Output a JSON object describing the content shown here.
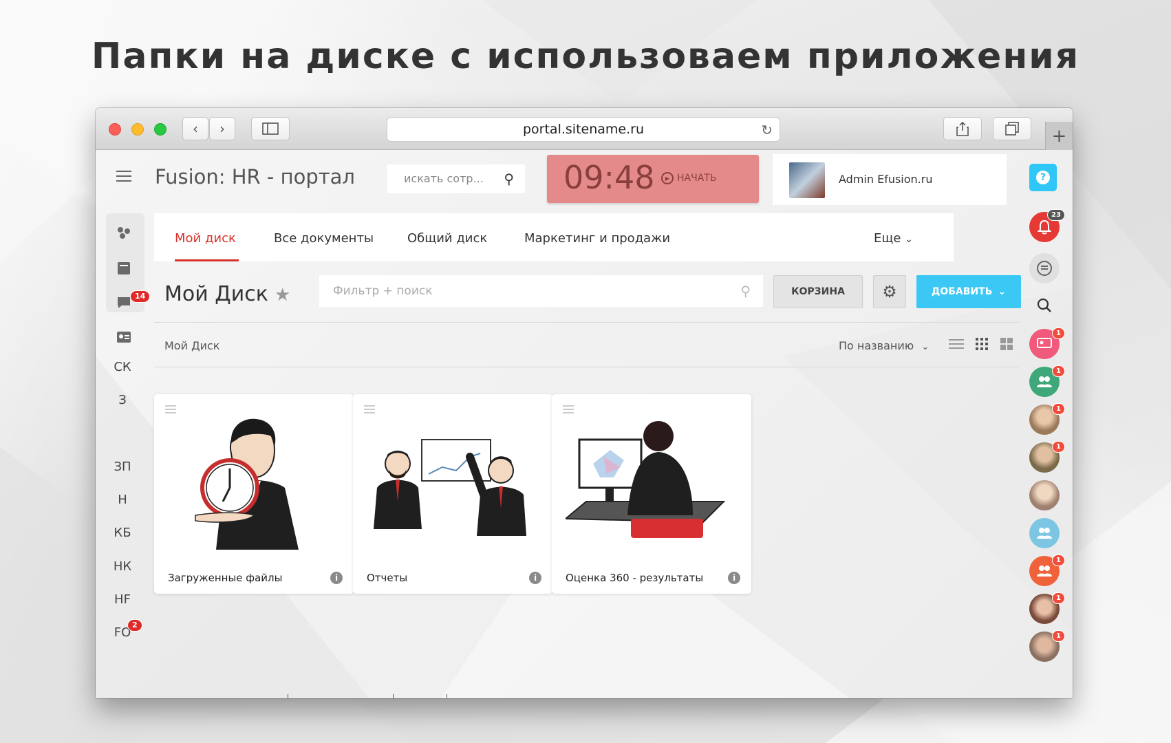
{
  "headline": "Папки на диске с использоваем приложения",
  "browser": {
    "url": "portal.sitename.ru"
  },
  "portal": {
    "title": "Fusion: HR - портал",
    "search_placeholder": "искать сотр...",
    "timer": {
      "time": "09:48",
      "start_label": "НАЧАТЬ"
    },
    "user": {
      "name": "Admin Efusion.ru"
    }
  },
  "left_sidebar": {
    "chat_badge": "14",
    "items": [
      "СК",
      "З",
      "ЗП",
      "Н",
      "КБ",
      "НК",
      "HF",
      "FO"
    ],
    "fo_badge": "2"
  },
  "tabs": [
    {
      "label": "Мой диск",
      "active": true
    },
    {
      "label": "Все документы",
      "active": false
    },
    {
      "label": "Общий диск",
      "active": false
    },
    {
      "label": "Маркетинг и продажи",
      "active": false
    }
  ],
  "tabs_more": "Еще",
  "disk": {
    "title": "Мой Диск",
    "filter_placeholder": "Фильтр + поиск",
    "trash_label": "КОРЗИНА",
    "add_label": "ДОБАВИТЬ",
    "breadcrumb": "Мой Диск",
    "sort_label": "По названию"
  },
  "folders": [
    {
      "label": "Загруженные файлы",
      "icon": "person-clock-illustration"
    },
    {
      "label": "Отчеты",
      "icon": "presentation-illustration"
    },
    {
      "label": "Оценка 360 - результаты",
      "icon": "computer-desk-illustration"
    }
  ],
  "right_sidebar": {
    "notifications_badge": "23",
    "contacts": [
      {
        "type": "group",
        "color": "#f15a7a",
        "badge": "1"
      },
      {
        "type": "group",
        "color": "#3fa87a",
        "badge": "1"
      },
      {
        "type": "avatar",
        "color": "#9a7a5a",
        "badge": "1"
      },
      {
        "type": "avatar",
        "color": "#7a6a4a",
        "badge": "1"
      },
      {
        "type": "avatar",
        "color": "#a08070",
        "badge": ""
      },
      {
        "type": "group",
        "color": "#7cc6e4",
        "badge": ""
      },
      {
        "type": "group",
        "color": "#f0623a",
        "badge": "1"
      },
      {
        "type": "avatar",
        "color": "#7a4a3a",
        "badge": "1"
      },
      {
        "type": "avatar",
        "color": "#8a7060",
        "badge": "1"
      }
    ]
  },
  "colors": {
    "accent_red": "#d8302a",
    "add_blue": "#3bc8f5",
    "timer_bg": "#e58a8a",
    "help_blue": "#2fc7f7"
  }
}
